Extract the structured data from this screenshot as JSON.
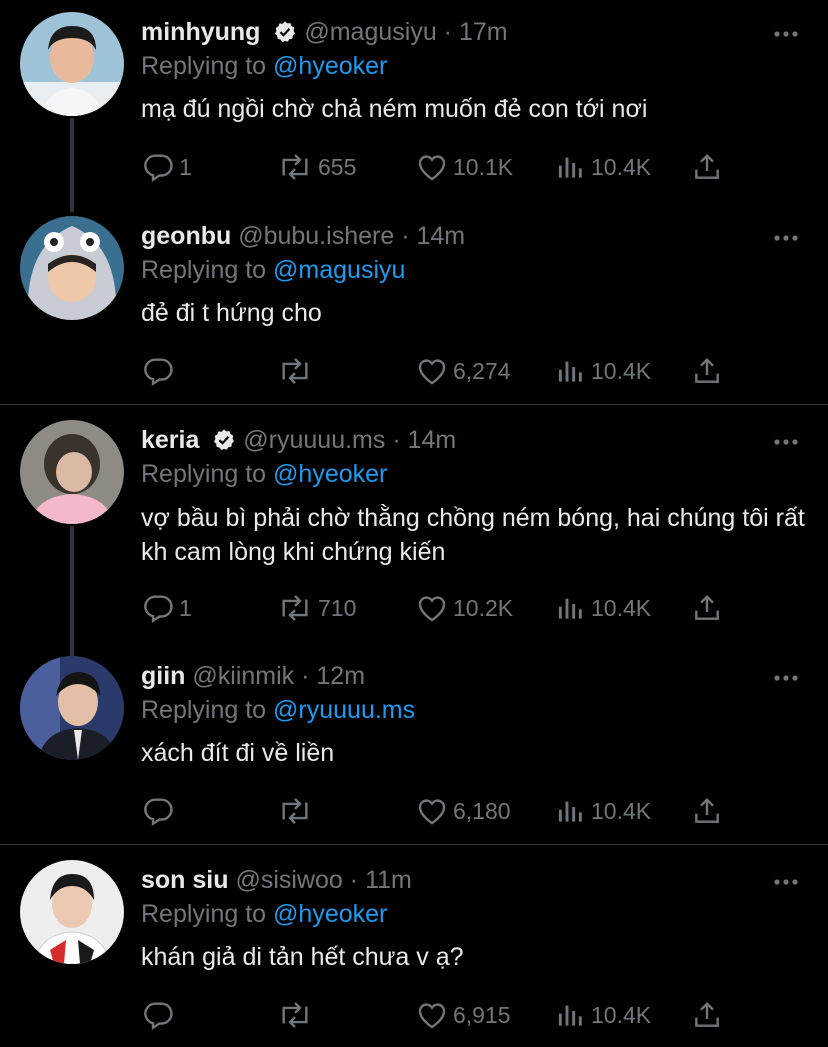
{
  "colors": {
    "background": "#000000",
    "text": "#e7e9ea",
    "muted": "#71767b",
    "accent": "#1d9bf0",
    "divider": "#2f3336"
  },
  "tweets": [
    {
      "name": "minhyung",
      "verified": true,
      "handle": "@magusiyu",
      "dot": "·",
      "time": "17m",
      "replying_label": "Replying to",
      "replying_to": "@hyeoker",
      "text": "mạ đú ngồi chờ chả ném muốn đẻ con tới nơi",
      "replies": "1",
      "retweets": "655",
      "likes": "10.1K",
      "views": "10.4K",
      "avatar": "avatar-minhyung"
    },
    {
      "name": "geonbu",
      "verified": false,
      "handle": "@bubu.ishere",
      "dot": "·",
      "time": "14m",
      "replying_label": "Replying to",
      "replying_to": "@magusiyu",
      "text": "đẻ đi t hứng cho",
      "replies": "",
      "retweets": "",
      "likes": "6,274",
      "views": "10.4K",
      "avatar": "avatar-geonbu"
    },
    {
      "name": "keria",
      "verified": true,
      "handle": "@ryuuuu.ms",
      "dot": "·",
      "time": "14m",
      "replying_label": "Replying to",
      "replying_to": "@hyeoker",
      "text": "vợ bầu bì phải chờ thằng chồng ném bóng, hai chúng tôi rất kh cam lòng khi chứng kiến",
      "replies": "1",
      "retweets": "710",
      "likes": "10.2K",
      "views": "10.4K",
      "avatar": "avatar-keria"
    },
    {
      "name": "giin",
      "verified": false,
      "handle": "@kiinmik",
      "dot": "·",
      "time": "12m",
      "replying_label": "Replying to",
      "replying_to": "@ryuuuu.ms",
      "text": "xách đít đi về liền",
      "replies": "",
      "retweets": "",
      "likes": "6,180",
      "views": "10.4K",
      "avatar": "avatar-giin"
    },
    {
      "name": "son siu",
      "verified": false,
      "handle": "@sisiwoo",
      "dot": "·",
      "time": "11m",
      "replying_label": "Replying to",
      "replying_to": "@hyeoker",
      "text": "khán giả di tản hết chưa v ạ?",
      "replies": "",
      "retweets": "",
      "likes": "6,915",
      "views": "10.4K",
      "avatar": "avatar-sonsiu"
    }
  ]
}
